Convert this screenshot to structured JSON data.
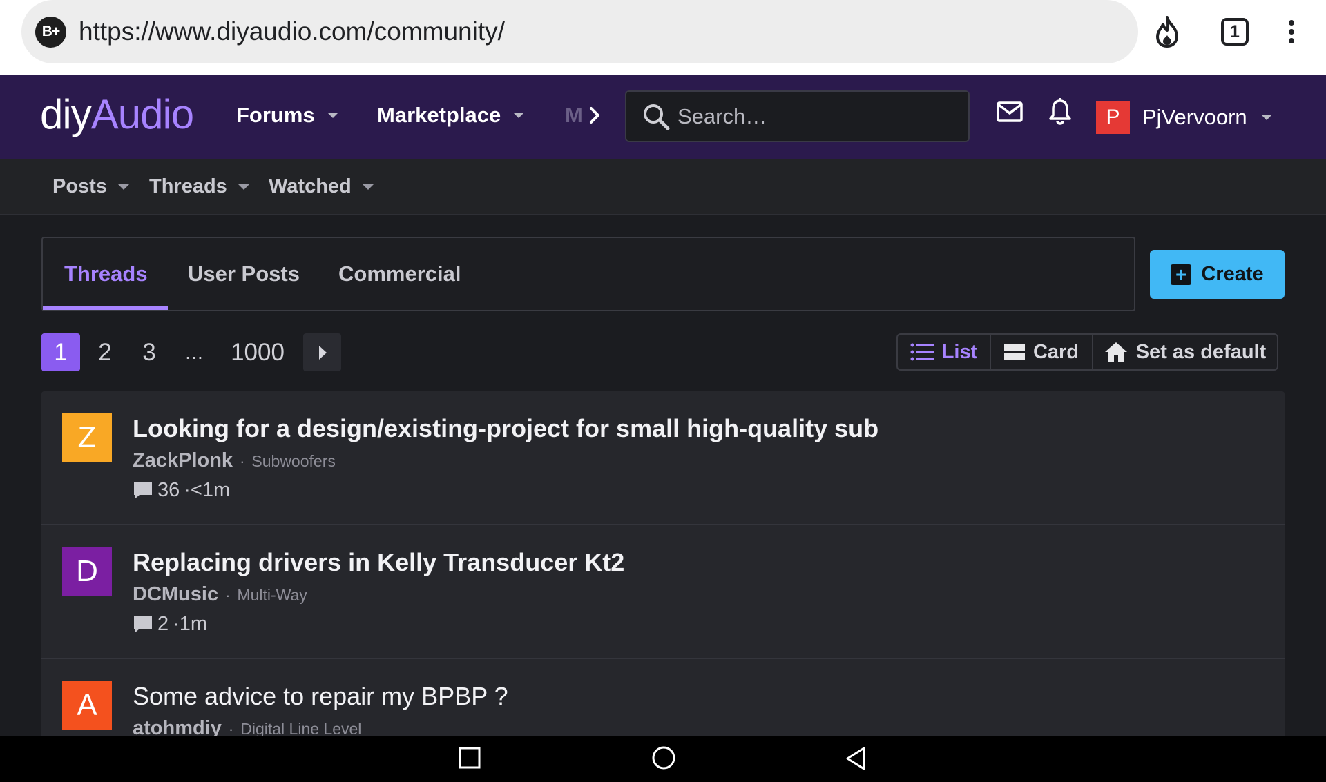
{
  "browser": {
    "site_badge": "B+",
    "url": "https://www.diyaudio.com/community/",
    "tab_count": "1"
  },
  "header": {
    "logo_part1": "diy",
    "logo_part2": "Audio",
    "nav": [
      {
        "label": "Forums"
      },
      {
        "label": "Marketplace"
      }
    ],
    "nav_more_partial": "M",
    "search_placeholder": "Search…",
    "user_initial": "P",
    "user_name": "PjVervoorn"
  },
  "sub_nav": [
    {
      "label": "Posts"
    },
    {
      "label": "Threads"
    },
    {
      "label": "Watched"
    }
  ],
  "tabs": [
    {
      "label": "Threads",
      "active": true
    },
    {
      "label": "User Posts"
    },
    {
      "label": "Commercial"
    }
  ],
  "create_label": "Create",
  "pagination": {
    "pages": [
      "1",
      "2",
      "3",
      "…",
      "1000"
    ],
    "current": "1"
  },
  "views": {
    "list": "List",
    "card": "Card",
    "default": "Set as default"
  },
  "threads": [
    {
      "initial": "Z",
      "avatar_color": "#f9a825",
      "title": "Looking for a design/existing-project for small high-quality sub",
      "author": "ZackPlonk",
      "forum": "Subwoofers",
      "replies": "36",
      "age": "·<1m",
      "unread": true
    },
    {
      "initial": "D",
      "avatar_color": "#7b1fa2",
      "title": "Replacing drivers in Kelly Transducer Kt2",
      "author": "DCMusic",
      "forum": "Multi-Way",
      "replies": "2",
      "age": "·1m",
      "unread": true
    },
    {
      "initial": "A",
      "avatar_color": "#f4511e",
      "title": "Some advice to repair my BPBP ?",
      "author": "atohmdiy",
      "forum": "Digital Line Level",
      "replies": "",
      "age": "",
      "unread": false
    }
  ],
  "colors": {
    "accent": "#a783ff",
    "header_bg": "#2b1a4d",
    "create_bg": "#41b8f5"
  }
}
